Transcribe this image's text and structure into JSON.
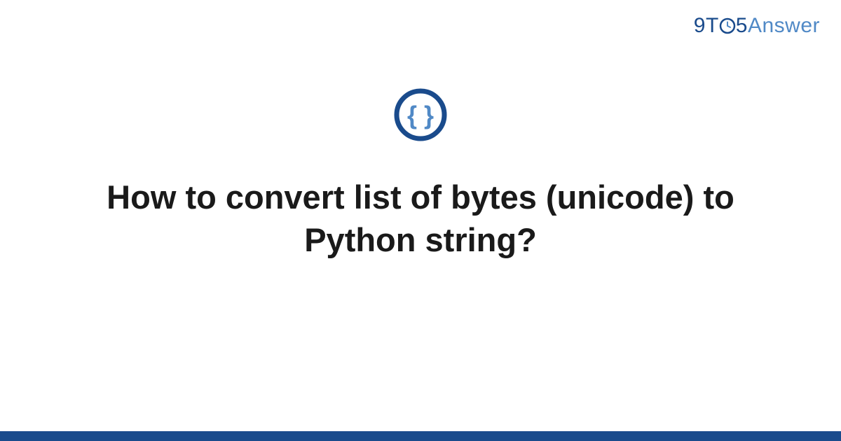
{
  "logo": {
    "part1": "9",
    "part2": "T",
    "part3": "5",
    "part4": "Answer"
  },
  "badge": {
    "icon_name": "code-braces-icon"
  },
  "title": "How to convert list of bytes (unicode) to Python string?",
  "colors": {
    "primary": "#1a4b8c",
    "secondary": "#5089c6",
    "text": "#1a1a1a"
  }
}
